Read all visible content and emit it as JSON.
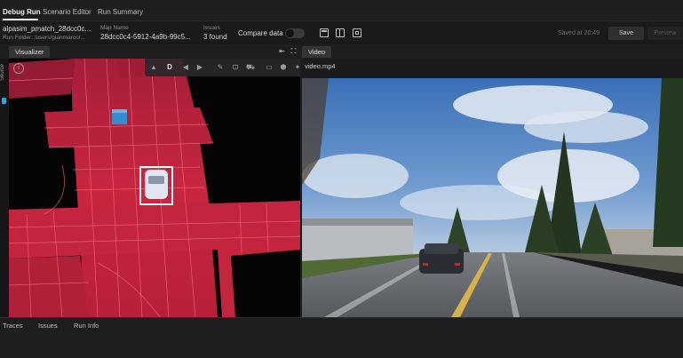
{
  "tabs": [
    "Debug Run",
    "Scenario Editor",
    "Run Summary"
  ],
  "run": {
    "name": "alpasim_pmatch_28dcc0c...",
    "folder": "Run Folder: /users/gianmarco/...",
    "map_label": "Map Name",
    "map_value": "28dcc0c4-5912-4a9b-99c5...",
    "issues_label": "Issues",
    "issues_value": "3 found"
  },
  "compare": {
    "label": "Compare data",
    "enabled": false
  },
  "status": {
    "saved": "Saved at 20:49"
  },
  "buttons": {
    "save": "Save",
    "preview": "Preview"
  },
  "visualizer": {
    "tab": "Visualizer",
    "side_label": "Source",
    "toolbar_letter": "D"
  },
  "video": {
    "tab": "Video",
    "filename": "video.mp4"
  },
  "bottom_tabs": [
    "Traces",
    "Issues",
    "Run Info"
  ],
  "colors": {
    "accent_grid": "#d42a45",
    "background": "#1c1c1e",
    "marker": "#2f8fd0"
  },
  "icons": {
    "compare_toggle": "toggle-switch",
    "layouts": [
      "layout-single-icon",
      "layout-split-icon",
      "layout-frame-icon"
    ],
    "viz_tools": [
      "triangle-warning-icon",
      "letter-d-icon",
      "arrow-left-icon",
      "arrow-right-icon",
      "pencil-icon",
      "focus-icon",
      "car-icon",
      "camera-icon",
      "cube-icon",
      "wrench-icon"
    ],
    "panel": [
      "collapse-left-icon",
      "fullscreen-icon",
      "info-icon"
    ]
  }
}
